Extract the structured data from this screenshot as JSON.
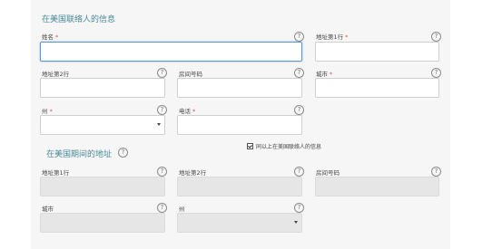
{
  "section1": {
    "title": "在美国联络人的信息",
    "surname_label": "姓名",
    "addr1_label": "地址第1行",
    "addr2_label": "地址第2行",
    "room_label": "房间号码",
    "city_label": "城市",
    "state_label": "州",
    "phone_label": "电话",
    "required_mark": "*",
    "help_glyph": "?"
  },
  "checkbox": {
    "label": "同以上在美国联络人的信息",
    "checked": true
  },
  "section2": {
    "title": "在美国期间的地址",
    "addr1_label": "地址第1行",
    "addr2_label": "地址第2行",
    "room_label": "房间号码",
    "city_label": "城市",
    "state_label": "州"
  }
}
